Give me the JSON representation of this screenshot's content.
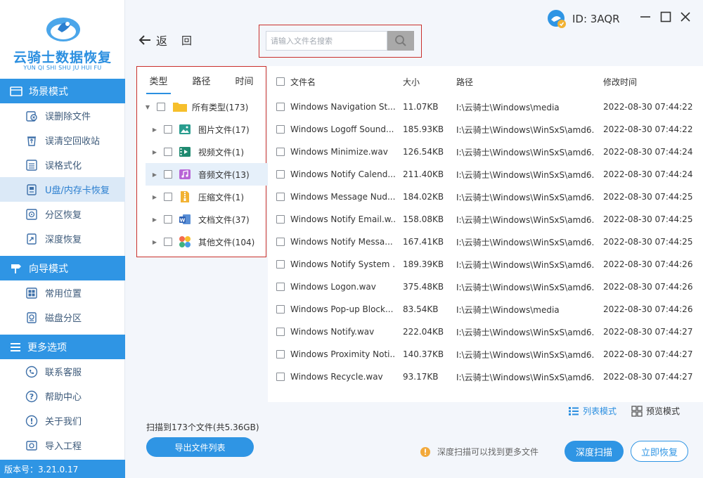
{
  "app": {
    "name": "云骑士数据恢复",
    "pinyin": "YUN QI SHI SHU JU HUI FU",
    "version": "版本号：3.21.0.17",
    "account_id": "ID: 3AQR"
  },
  "colors": {
    "accent": "#2f95e4",
    "highlight_border": "#c9302c",
    "active_item_bg": "#dbe9f7"
  },
  "sidebar": {
    "sections": [
      {
        "title": "场景模式",
        "icon": "scene-icon"
      },
      {
        "title": "向导模式",
        "icon": "guide-icon"
      },
      {
        "title": "更多选项",
        "icon": "menu-icon"
      }
    ],
    "items": [
      {
        "label": "误删除文件",
        "icon": "delete-file-icon"
      },
      {
        "label": "误清空回收站",
        "icon": "recycle-bin-icon"
      },
      {
        "label": "误格式化",
        "icon": "format-icon"
      },
      {
        "label": "U盘/内存卡恢复",
        "icon": "usb-drive-icon",
        "active": true
      },
      {
        "label": "分区恢复",
        "icon": "partition-icon"
      },
      {
        "label": "深度恢复",
        "icon": "deep-recovery-icon"
      },
      {
        "label": "常用位置",
        "icon": "common-location-icon"
      },
      {
        "label": "磁盘分区",
        "icon": "disk-partition-icon"
      },
      {
        "label": "联系客服",
        "icon": "customer-service-icon"
      },
      {
        "label": "帮助中心",
        "icon": "help-icon"
      },
      {
        "label": "关于我们",
        "icon": "about-icon"
      },
      {
        "label": "导入工程",
        "icon": "import-icon"
      }
    ]
  },
  "toolbar": {
    "back_label": "返",
    "back_label2": "回",
    "search_placeholder": "请输入文件名搜索"
  },
  "tree": {
    "tabs": [
      "类型",
      "路径",
      "时间"
    ],
    "active_tab": "类型",
    "rows": [
      {
        "label": "所有类型(173)",
        "icon": "folder-icon",
        "expanded": true
      },
      {
        "label": "图片文件(17)",
        "icon": "image-file-icon"
      },
      {
        "label": "视频文件(1)",
        "icon": "video-file-icon"
      },
      {
        "label": "音频文件(13)",
        "icon": "audio-file-icon",
        "highlighted": true
      },
      {
        "label": "压缩文件(1)",
        "icon": "archive-file-icon"
      },
      {
        "label": "文档文件(37)",
        "icon": "document-file-icon"
      },
      {
        "label": "其他文件(104)",
        "icon": "other-file-icon"
      }
    ]
  },
  "table": {
    "headers": {
      "name": "文件名",
      "size": "大小",
      "path": "路径",
      "modified": "修改时间"
    },
    "rows": [
      {
        "name": "Windows Navigation St...",
        "size": "11.07KB",
        "path": "I:\\云骑士\\Windows\\media",
        "modified": "2022-08-30 07:44:22"
      },
      {
        "name": "Windows Logoff Sound...",
        "size": "185.93KB",
        "path": "I:\\云骑士\\Windows\\WinSxS\\amd6...",
        "modified": "2022-08-30 07:44:22"
      },
      {
        "name": "Windows Minimize.wav",
        "size": "126.54KB",
        "path": "I:\\云骑士\\Windows\\WinSxS\\amd6...",
        "modified": "2022-08-30 07:44:24"
      },
      {
        "name": "Windows Notify Calend...",
        "size": "211.40KB",
        "path": "I:\\云骑士\\Windows\\WinSxS\\amd6...",
        "modified": "2022-08-30 07:44:24"
      },
      {
        "name": "Windows Message Nud...",
        "size": "184.02KB",
        "path": "I:\\云骑士\\Windows\\WinSxS\\amd6...",
        "modified": "2022-08-30 07:44:25"
      },
      {
        "name": "Windows Notify Email.w...",
        "size": "158.08KB",
        "path": "I:\\云骑士\\Windows\\WinSxS\\amd6...",
        "modified": "2022-08-30 07:44:25"
      },
      {
        "name": "Windows Notify Messa...",
        "size": "167.41KB",
        "path": "I:\\云骑士\\Windows\\WinSxS\\amd6...",
        "modified": "2022-08-30 07:44:25"
      },
      {
        "name": "Windows Notify System ...",
        "size": "189.39KB",
        "path": "I:\\云骑士\\Windows\\WinSxS\\amd6...",
        "modified": "2022-08-30 07:44:26"
      },
      {
        "name": "Windows Logon.wav",
        "size": "375.48KB",
        "path": "I:\\云骑士\\Windows\\WinSxS\\amd6...",
        "modified": "2022-08-30 07:44:26"
      },
      {
        "name": "Windows Pop-up Block...",
        "size": "83.54KB",
        "path": "I:\\云骑士\\Windows\\media",
        "modified": "2022-08-30 07:44:26"
      },
      {
        "name": "Windows Notify.wav",
        "size": "222.04KB",
        "path": "I:\\云骑士\\Windows\\WinSxS\\amd6...",
        "modified": "2022-08-30 07:44:27"
      },
      {
        "name": "Windows Proximity Noti...",
        "size": "140.37KB",
        "path": "I:\\云骑士\\Windows\\WinSxS\\amd6...",
        "modified": "2022-08-30 07:44:27"
      },
      {
        "name": "Windows Recycle.wav",
        "size": "93.17KB",
        "path": "I:\\云骑士\\Windows\\WinSxS\\amd6...",
        "modified": "2022-08-30 07:44:27"
      }
    ]
  },
  "footer": {
    "scan_info": "扫描到173个文件(共5.36GB)",
    "export_label": "导出文件列表",
    "list_view_label": "列表模式",
    "preview_view_label": "预览模式",
    "hint": "深度扫描可以找到更多文件",
    "deep_scan_label": "深度扫描",
    "recover_label": "立即恢复"
  }
}
